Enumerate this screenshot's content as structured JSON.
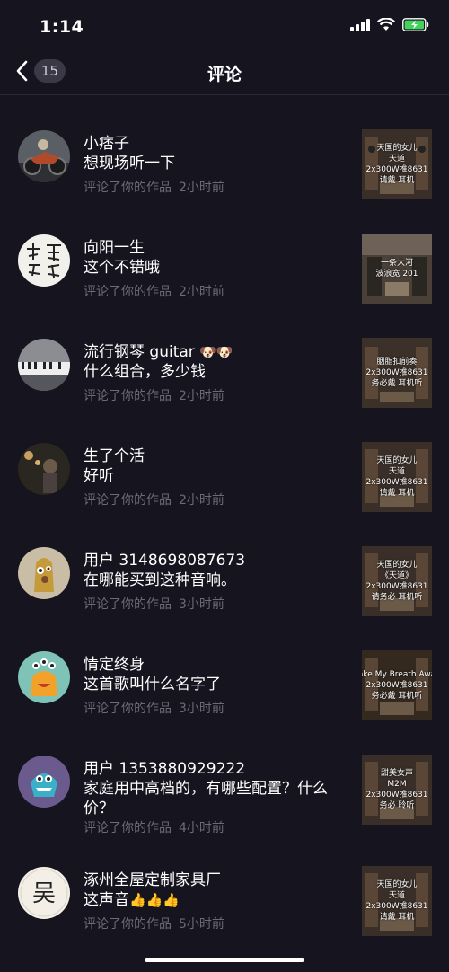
{
  "status_bar": {
    "time": "1:14"
  },
  "header": {
    "back_count": "15",
    "title": "评论"
  },
  "comments": [
    {
      "name": "小痞子",
      "text": "想现场听一下",
      "action": "评论了你的作品",
      "time": "2小时前",
      "thumb_lines": [
        "天国的女儿",
        "天道",
        "2x300W推8631",
        "请戴 耳机"
      ]
    },
    {
      "name": "向阳一生",
      "text": "这个不错哦",
      "action": "评论了你的作品",
      "time": "2小时前",
      "thumb_lines": [
        "一条大河",
        "波浪宽 201"
      ]
    },
    {
      "name": "流行钢琴 guitar",
      "name_emoji": "🐶🐶",
      "text": "什么组合，多少钱",
      "action": "评论了你的作品",
      "time": "2小时前",
      "thumb_lines": [
        "胭脂扣前奏",
        "2x300W推8631",
        "务必戴 耳机听"
      ]
    },
    {
      "name": "生了个活",
      "text": "好听",
      "action": "评论了你的作品",
      "time": "2小时前",
      "thumb_lines": [
        "天国的女儿",
        "天道",
        "2x300W推8631",
        "请戴 耳机"
      ]
    },
    {
      "name": "用户 3148698087673",
      "text": "在哪能买到这种音响。",
      "action": "评论了你的作品",
      "time": "3小时前",
      "thumb_lines": [
        "天国的女儿",
        "《天道》",
        "2x300W推8631",
        "请务必 耳机听"
      ]
    },
    {
      "name": "情定终身",
      "text": "这首歌叫什么名字了",
      "action": "评论了你的作品",
      "time": "3小时前",
      "thumb_lines": [
        "ake My Breath Awa",
        "2x300W推8631",
        "务必戴 耳机听"
      ]
    },
    {
      "name": "用户 1353880929222",
      "text": "家庭用中高档的，有哪些配置？什么价？",
      "action": "评论了你的作品",
      "time": "4小时前",
      "thumb_lines": [
        "甜美女声",
        "M2M",
        "2x300W推8631",
        "务必 聆听"
      ]
    },
    {
      "name": "涿州全屋定制家具厂",
      "text": "这声音",
      "text_emoji": "👍👍👍",
      "avatar_char": "吴",
      "action": "评论了你的作品",
      "time": "5小时前",
      "thumb_lines": [
        "天国的女儿",
        "天道",
        "2x300W推8631",
        "请戴 耳机"
      ]
    }
  ]
}
